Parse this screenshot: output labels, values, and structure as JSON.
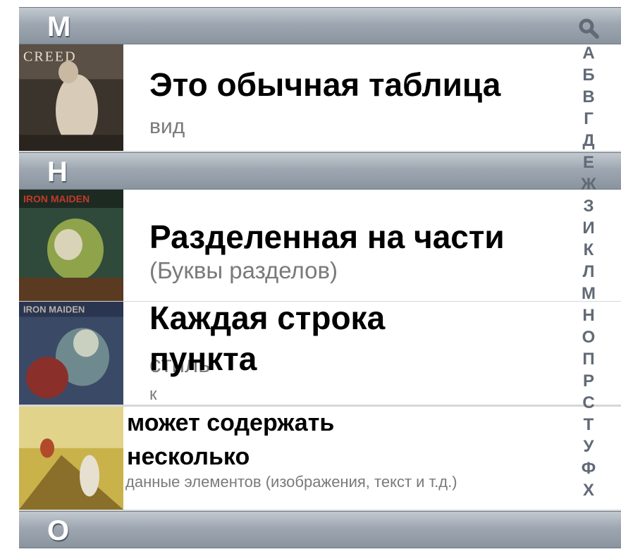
{
  "sections": [
    {
      "letter": "М"
    },
    {
      "letter": "Н"
    },
    {
      "letter": "О"
    }
  ],
  "rows": [
    {
      "title": "Это обычная таблица",
      "subtitle": "вид",
      "album_text": "CREED"
    },
    {
      "title": "Разделенная на части",
      "subtitle": "(Буквы разделов)",
      "album_text": "IRON MAIDEN"
    },
    {
      "title_line1": "Каждая строка",
      "title_line2": "пункта",
      "subtitle_line1": "стиль",
      "subtitle_line2": "к",
      "album_text": "IRON MAIDEN"
    },
    {
      "title_line1": "может содержать",
      "title_line2": "несколько",
      "subtitle": "данные элементов (изображения, текст и т.д.)"
    }
  ],
  "index": {
    "search_icon": "search-icon",
    "letters": [
      "А",
      "Б",
      "В",
      "Г",
      "Д",
      "Е",
      "Ж",
      "З",
      "И",
      "К",
      "Л",
      "М",
      "Н",
      "О",
      "П",
      "Р",
      "С",
      "Т",
      "У",
      "Ф",
      "Х"
    ]
  }
}
